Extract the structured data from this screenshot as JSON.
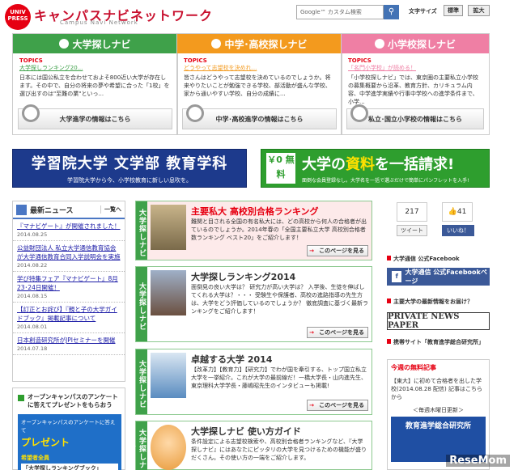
{
  "header": {
    "logo_badge": "UNIV PRESS",
    "logo_text": "キャンパスナビネットワーク",
    "logo_sub": "Campus Navi Network",
    "search_placeholder": "Google™ カスタム検索",
    "font_size_label": "文字サイズ",
    "font_standard": "標準",
    "font_large": "拡大"
  },
  "panels": [
    {
      "title": "大学探しナビ",
      "color": "#3fa14a",
      "topics": "TOPICS",
      "link": "大学探しランキング20...",
      "body": "日本には国公私立を合わせておよそ800近い大学が存在します。その中で、自分の将来の夢や希望に合った「1校」を選び出すのは\"至難の業\"といっ...",
      "footer": "大学進学の情報はこちら"
    },
    {
      "title": "中学･高校探しナビ",
      "color": "#f39a1e",
      "topics": "TOPICS",
      "link": "どうやって志望校を決めれ...",
      "body": "皆さんはどうやって志望校を決めているのでしょうか。将来やりたいことが勉強できる学校、部活動が盛んな学校、家から通いやすい学校、自分の成績に...",
      "footer": "中学･高校進学の情報はこちら"
    },
    {
      "title": "小学校探しナビ",
      "color": "#ef7fa4",
      "topics": "TOPICS",
      "link": "「名門小学校」が読める！",
      "body": "「小学校探しナビ」では、東京圏の主要私立小学校の募集概要から沿革、教育方針、カリキュラム内容、中学進学実績や行事中学校への進学条件まで、小学...",
      "footer": "私立･国立小学校の情報はこちら"
    }
  ],
  "banners": {
    "left_title": "学習院大学 文学部 教育学科",
    "left_sub": "学習院大学から今、小学校教育に新しい息吹を。",
    "right_free": "￥0 無料",
    "right_title_a": "大学の",
    "right_title_b": "資料",
    "right_title_c": "を一括請求!",
    "right_sub": "面倒な会員登録なし。大学名を一括で選ぶだけで簡単にパンフレットを入手!"
  },
  "news": {
    "title": "最新ニュース",
    "more": "一覧へ",
    "items": [
      {
        "text": "『マナビゲート』が開催されました！",
        "date": "2014.08.25"
      },
      {
        "text": "公益財団法人 私立大学通信教育協会が大学通信教育合同入学説明会を実施",
        "date": "2014.08.22"
      },
      {
        "text": "学び特集フェア『マナビゲート』8月23･24日開催！",
        "date": "2014.08.15"
      },
      {
        "text": "【訂正とお詫び】『親と子の大学ガイドブック』掲載記事について",
        "date": "2014.08.01"
      },
      {
        "text": "日本創造研究所がJPIセミナーを開催",
        "date": "2014.07.18"
      }
    ]
  },
  "campaign": {
    "title": "オープンキャンパスのアンケートに答えてプレゼントをもらおう",
    "ad_line1": "オープンキャンパスのアンケートに答えて",
    "ad_line2": "プレゼント",
    "ad_line3": "希望者全員",
    "ad_line4": "「大学探しランキングブック」"
  },
  "center": {
    "tab_label": "大学探しナビ",
    "see_more": "このページを見る",
    "cards": [
      {
        "title": "主要私大 高校別合格ランキング",
        "title_color": "#e60012",
        "body": "難関と目される全国の有名私大には、どの高校から何人の合格者が出ているのでしょうか。2014年春の「全国主要私立大学 高校別合格者数ランキング ベスト20」をご紹介します！"
      },
      {
        "title": "大学探しランキング2014",
        "title_color": "#111111",
        "body": "面倒見の良い大学は？ 研究力が高い大学は？ 入学後、生徒を伸ばしてくれる大学は？・・・ 受験生や保護者、高校の進路指導の先生方は、大学をどう評価しているのでしょうか？ 徹底調査に基づく最新ランキングをご紹介します！"
      },
      {
        "title": "卓越する大学 2014",
        "title_color": "#111111",
        "body": "【改革力】【教育力】【研究力】でわが国を牽引する、トップ国立私立大学を一挙紹介。これが大学の最前線だ！一橋大学長・山内進先生、東京理科大学学長・藤嶋昭先生のインタビューも掲載!"
      },
      {
        "title": "大学探しナビ 使い方ガイド",
        "title_color": "#111111",
        "body": "条件設定による志望校検索や、高校別合格者ランキングなど、『大学探しナビ』にはあなたにピッタリの大学を見つけるための機能が盛りだくさん。その使い方の一端をご紹介します。"
      }
    ]
  },
  "right": {
    "share_count": "217",
    "like_count": "41",
    "tweet": "ツイート",
    "like": "いいね！",
    "fb_heading": "大学通信 公式Facebook",
    "fb_banner": "大学通信 公式Facebookページ",
    "survey_heading": "主要大学の最新情報をお届け？",
    "pnp": "PRIVATE NEWS PAPER",
    "related_heading": "携帯サイト「教育進学総合研究所」",
    "today_label": "今週の無料記事",
    "today_body": "【東大】に初めて合格者を出した学校(2014.08.28 配信) 記事はこちらから",
    "weekly": "＜毎週木曜日更新＞",
    "sokenkyu": "教育進学総合研究所",
    "watermark": "ReseMom"
  },
  "colors": {
    "accent_red": "#e60012",
    "green": "#3fa14a",
    "orange": "#f39a1e",
    "pink": "#ef7fa4",
    "navy": "#1d3a8c",
    "facebook": "#3b5998"
  }
}
